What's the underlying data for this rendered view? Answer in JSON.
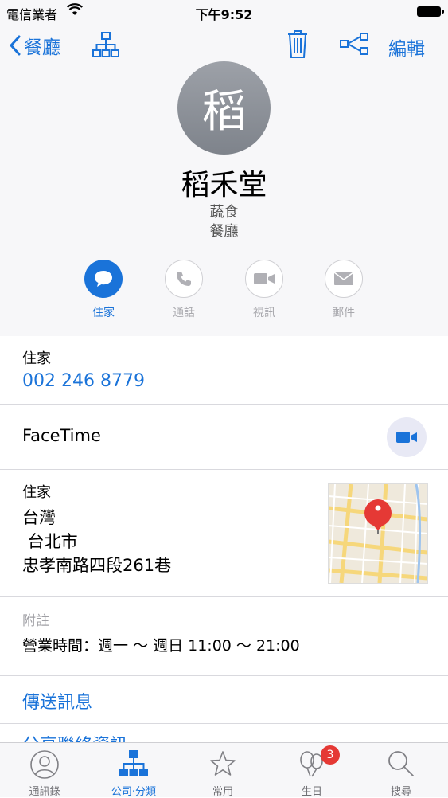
{
  "status_bar": {
    "carrier": "電信業者",
    "time": "下午9:52"
  },
  "nav": {
    "back_label": "餐廳",
    "edit_label": "編輯"
  },
  "contact": {
    "avatar_initial": "稻",
    "name": "稻禾堂",
    "subtitle_1": "蔬食",
    "subtitle_2": "餐廳"
  },
  "actions": [
    {
      "label": "住家",
      "active": true
    },
    {
      "label": "通話",
      "active": false
    },
    {
      "label": "視訊",
      "active": false
    },
    {
      "label": "郵件",
      "active": false
    }
  ],
  "phone": {
    "label": "住家",
    "number": "002 246 8779"
  },
  "facetime": {
    "label": "FaceTime"
  },
  "address": {
    "label": "住家",
    "country": "台灣",
    "city": " 台北市",
    "street": "忠孝南路四段261巷"
  },
  "notes": {
    "label": "附註",
    "text": "營業時間：週一 ～ 週日 11:00 ～ 21:00"
  },
  "links": {
    "send_message": "傳送訊息",
    "share_contact": "分享聯絡資訊"
  },
  "tabbar": {
    "tabs": [
      {
        "label": "通訊錄",
        "selected": false
      },
      {
        "label": "公司·分類",
        "selected": true
      },
      {
        "label": "常用",
        "selected": false
      },
      {
        "label": "生日",
        "selected": false
      },
      {
        "label": "搜尋",
        "selected": false
      }
    ],
    "birthday_badge": "3"
  },
  "colors": {
    "accent": "#1a73d9",
    "badge": "#e53935",
    "avatar": "#8a8e95"
  }
}
